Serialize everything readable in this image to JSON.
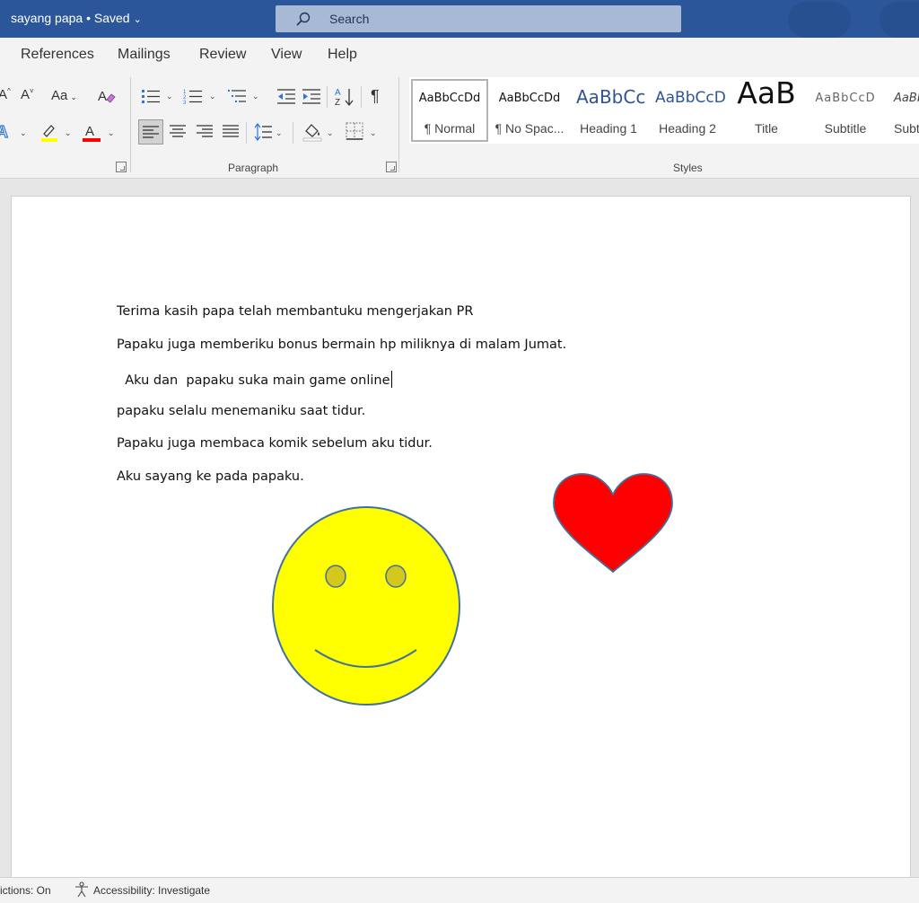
{
  "titlebar": {
    "doc_title": "sayang papa • Saved",
    "search_placeholder": "Search"
  },
  "tabs": [
    "References",
    "Mailings",
    "Review",
    "View",
    "Help"
  ],
  "ribbon": {
    "font_case_label": "Aa",
    "paragraph_group": "Paragraph",
    "styles_group": "Styles",
    "highlight_color": "#ffff00",
    "font_color": "#ff0000",
    "styles": [
      {
        "sample": "AaBbCcDd",
        "name": "¶ Normal"
      },
      {
        "sample": "AaBbCcDd",
        "name": "¶ No Spac..."
      },
      {
        "sample": "AaBbCc",
        "name": "Heading 1"
      },
      {
        "sample": "AaBbCcD",
        "name": "Heading 2"
      },
      {
        "sample": "AaB",
        "name": "Title"
      },
      {
        "sample": "AaBbCcD",
        "name": "Subtitle"
      },
      {
        "sample": "AaBb",
        "name": "Subt"
      }
    ]
  },
  "document": {
    "paragraphs": [
      "Terima kasih papa telah membantuku mengerjakan PR",
      "Papaku juga memberiku bonus bermain hp miliknya di malam Jumat.",
      "  Aku dan  papaku suka main game online",
      "papaku selalu menemaniku saat tidur.",
      "Papaku juga membaca komik sebelum aku tidur.",
      "Aku sayang ke pada papaku."
    ],
    "shapes": {
      "smiley_fill": "#ffff00",
      "smiley_eye_fill": "#d4c81c",
      "shape_outline": "#41719c",
      "heart_fill": "#ff0000"
    }
  },
  "status": {
    "predictions": "ictions: On",
    "accessibility": "Accessibility: Investigate"
  }
}
